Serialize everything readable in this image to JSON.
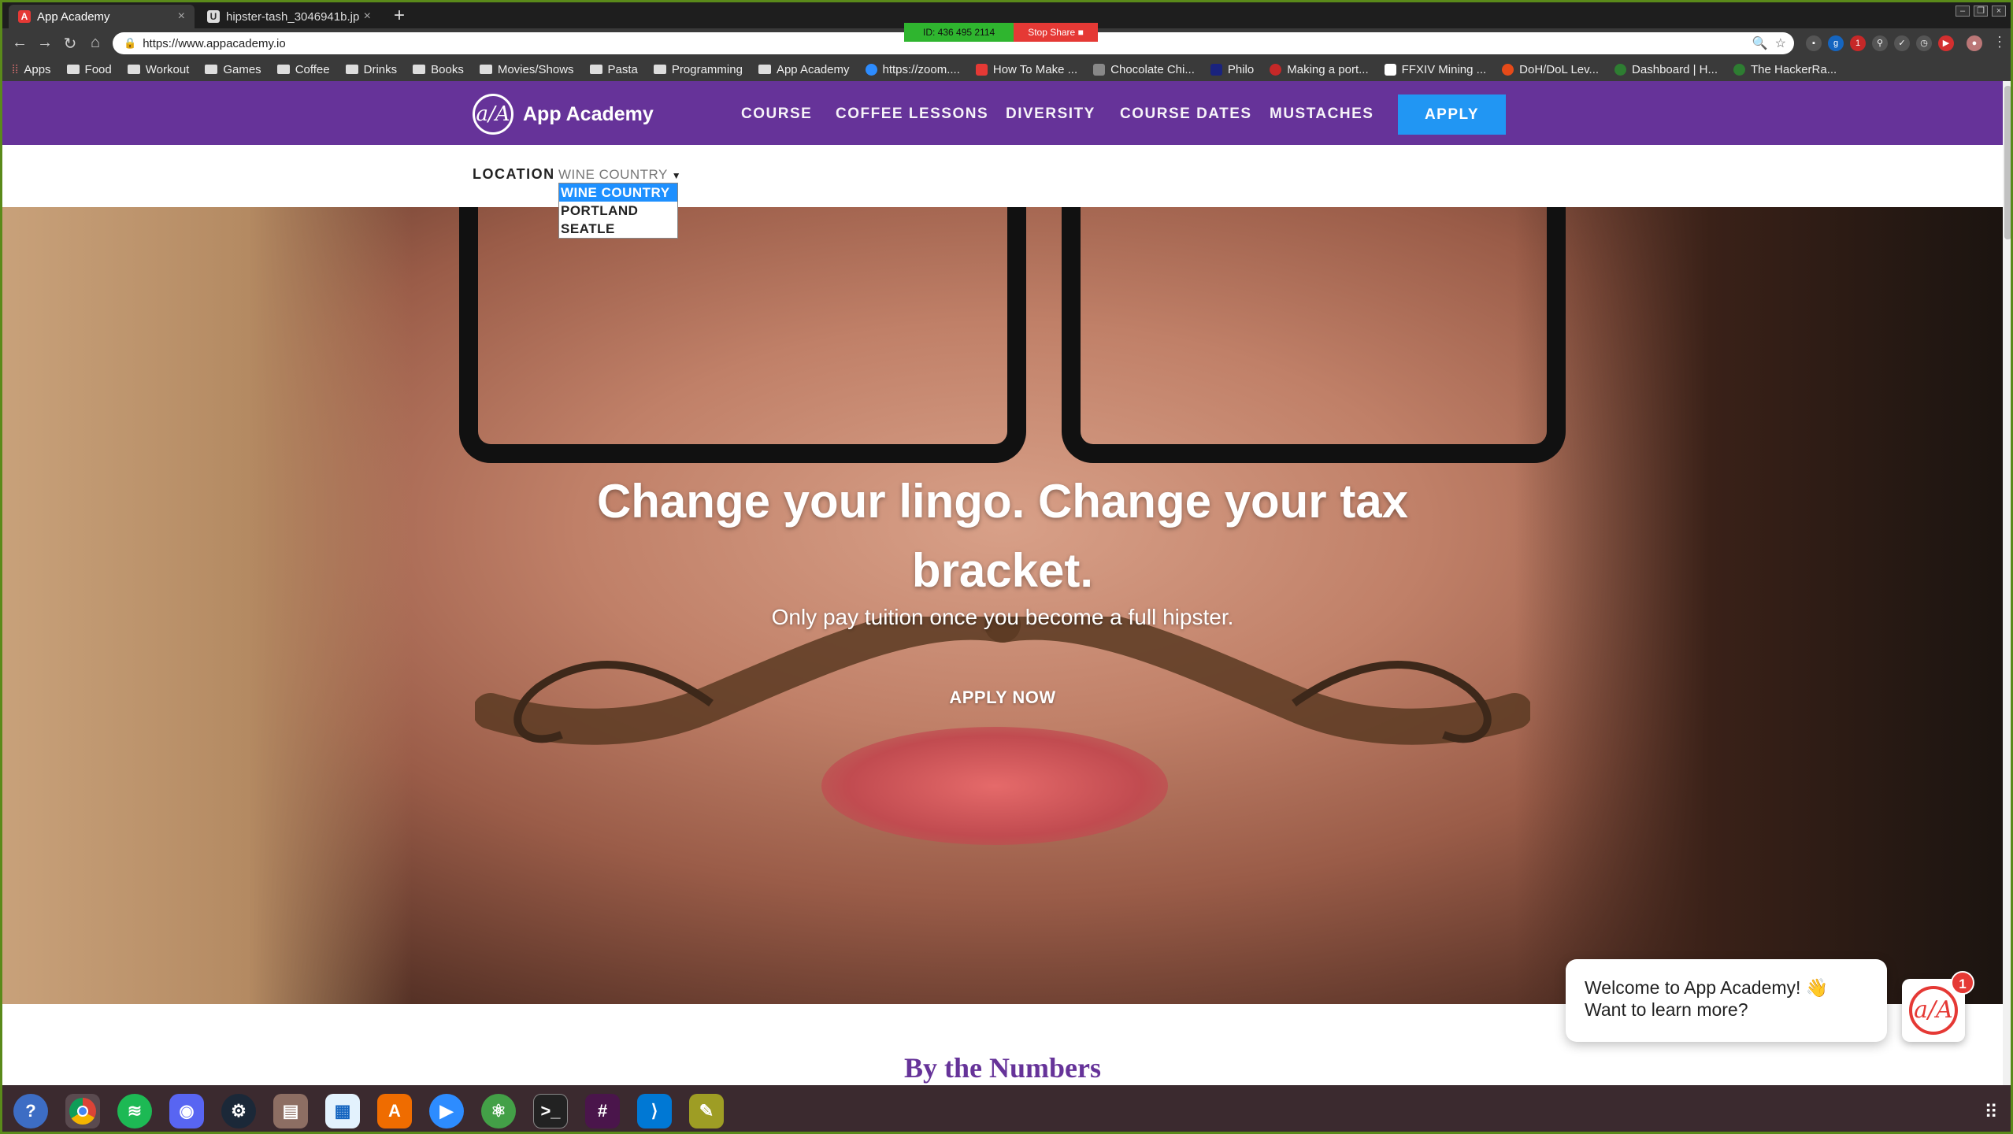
{
  "browser": {
    "tabs": [
      {
        "title": "App Academy",
        "favicon": "app-academy-favicon",
        "active": true
      },
      {
        "title": "hipster-tash_3046941b.jp",
        "favicon": "image-favicon",
        "active": false
      }
    ],
    "url": "https://www.appacademy.io",
    "screen_share": {
      "id": "ID: 436 495 2114",
      "stop": "Stop Share"
    },
    "bookmarks": [
      "Apps",
      "Food",
      "Workout",
      "Games",
      "Coffee",
      "Drinks",
      "Books",
      "Movies/Shows",
      "Pasta",
      "Programming",
      "App Academy",
      "https://zoom....",
      "How To Make ...",
      "Chocolate Chi...",
      "Philo",
      "Making a port...",
      "FFXIV Mining ...",
      "DoH/DoL Lev...",
      "Dashboard | H...",
      "The HackerRa..."
    ]
  },
  "site": {
    "logo_mark": "a/A",
    "logo_name": "App Academy",
    "nav": [
      "COURSE",
      "COFFEE LESSONS",
      "DIVERSITY",
      "COURSE DATES",
      "MUSTACHES"
    ],
    "apply": "APPLY",
    "location_label": "LOCATION",
    "location_selected": "WINE COUNTRY",
    "location_options": [
      "WINE COUNTRY",
      "PORTLAND",
      "SEATLE"
    ],
    "headline": "Change your lingo. Change your tax bracket.",
    "subheadline": "Only pay tuition once you become a full hipster.",
    "cta": "APPLY NOW",
    "section_title": "By the Numbers",
    "chat": {
      "message_line1": "Welcome to App Academy! 👋",
      "message_line2": "Want to learn more?",
      "badge": "1",
      "launcher_mark": "a/A"
    },
    "colors": {
      "brand_purple": "#663399",
      "apply_blue": "#2196f3",
      "chat_red": "#e53935"
    }
  },
  "taskbar": {
    "icons": [
      "help-icon",
      "chrome-icon",
      "spotify-icon",
      "discord-icon",
      "steam-icon",
      "files-icon",
      "document-icon",
      "software-store-icon",
      "zoom-icon",
      "atom-icon",
      "terminal-icon",
      "slack-icon",
      "vscode-icon",
      "image-viewer-icon"
    ],
    "apps_grid_icon": "apps-grid-icon"
  }
}
